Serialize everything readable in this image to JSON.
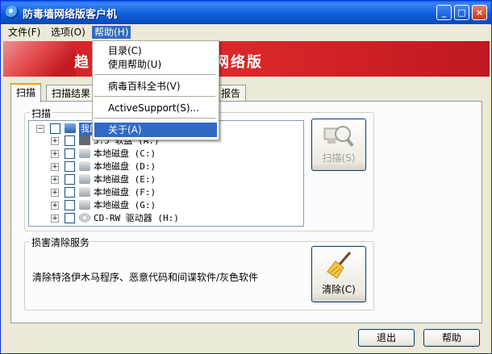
{
  "window": {
    "title": "防毒墙网络版客户机"
  },
  "titlebar_buttons": {
    "minimize": "_",
    "maximize": "□",
    "close": "×"
  },
  "menubar": [
    {
      "label": "文件(F)"
    },
    {
      "label": "选项(O)"
    },
    {
      "label": "帮助(H)"
    }
  ],
  "banner": {
    "left_text": "趋",
    "right_text": "网络版"
  },
  "tabs": [
    {
      "label": "扫描"
    },
    {
      "label": "扫描结果"
    },
    {
      "label": "报告"
    }
  ],
  "scan_group": {
    "label": "扫描"
  },
  "tree": {
    "root": {
      "label": "我的电脑"
    },
    "items": [
      {
        "label": "3.5 软盘 (A:)",
        "icon": "floppy-icon"
      },
      {
        "label": "本地磁盘 (C:)",
        "icon": "drive-icon"
      },
      {
        "label": "本地磁盘 (D:)",
        "icon": "drive-icon"
      },
      {
        "label": "本地磁盘 (E:)",
        "icon": "drive-icon"
      },
      {
        "label": "本地磁盘 (F:)",
        "icon": "drive-icon"
      },
      {
        "label": "本地磁盘 (G:)",
        "icon": "drive-icon"
      },
      {
        "label": "CD-RW 驱动器 (H:)",
        "icon": "cd-icon"
      }
    ]
  },
  "scan_button": {
    "label": "扫描(S)",
    "enabled": false
  },
  "damage_group": {
    "label": "损害清除服务",
    "description": "清除特洛伊木马程序、恶意代码和间谍软件/灰色软件"
  },
  "clean_button": {
    "label": "清除(C)"
  },
  "bottom_buttons": {
    "exit": "退出",
    "help": "帮助"
  },
  "help_menu": {
    "items": [
      {
        "label": "目录(C)"
      },
      {
        "label": "使用帮助(U)"
      },
      {
        "label": "病毒百科全书(V)"
      },
      {
        "label": "ActiveSupport(S)..."
      },
      {
        "label": "关于(A)",
        "highlighted": true
      }
    ]
  },
  "colors": {
    "accent": "#316ac5",
    "banner": "#d0202a",
    "titlebar": "#0a5fe7"
  }
}
